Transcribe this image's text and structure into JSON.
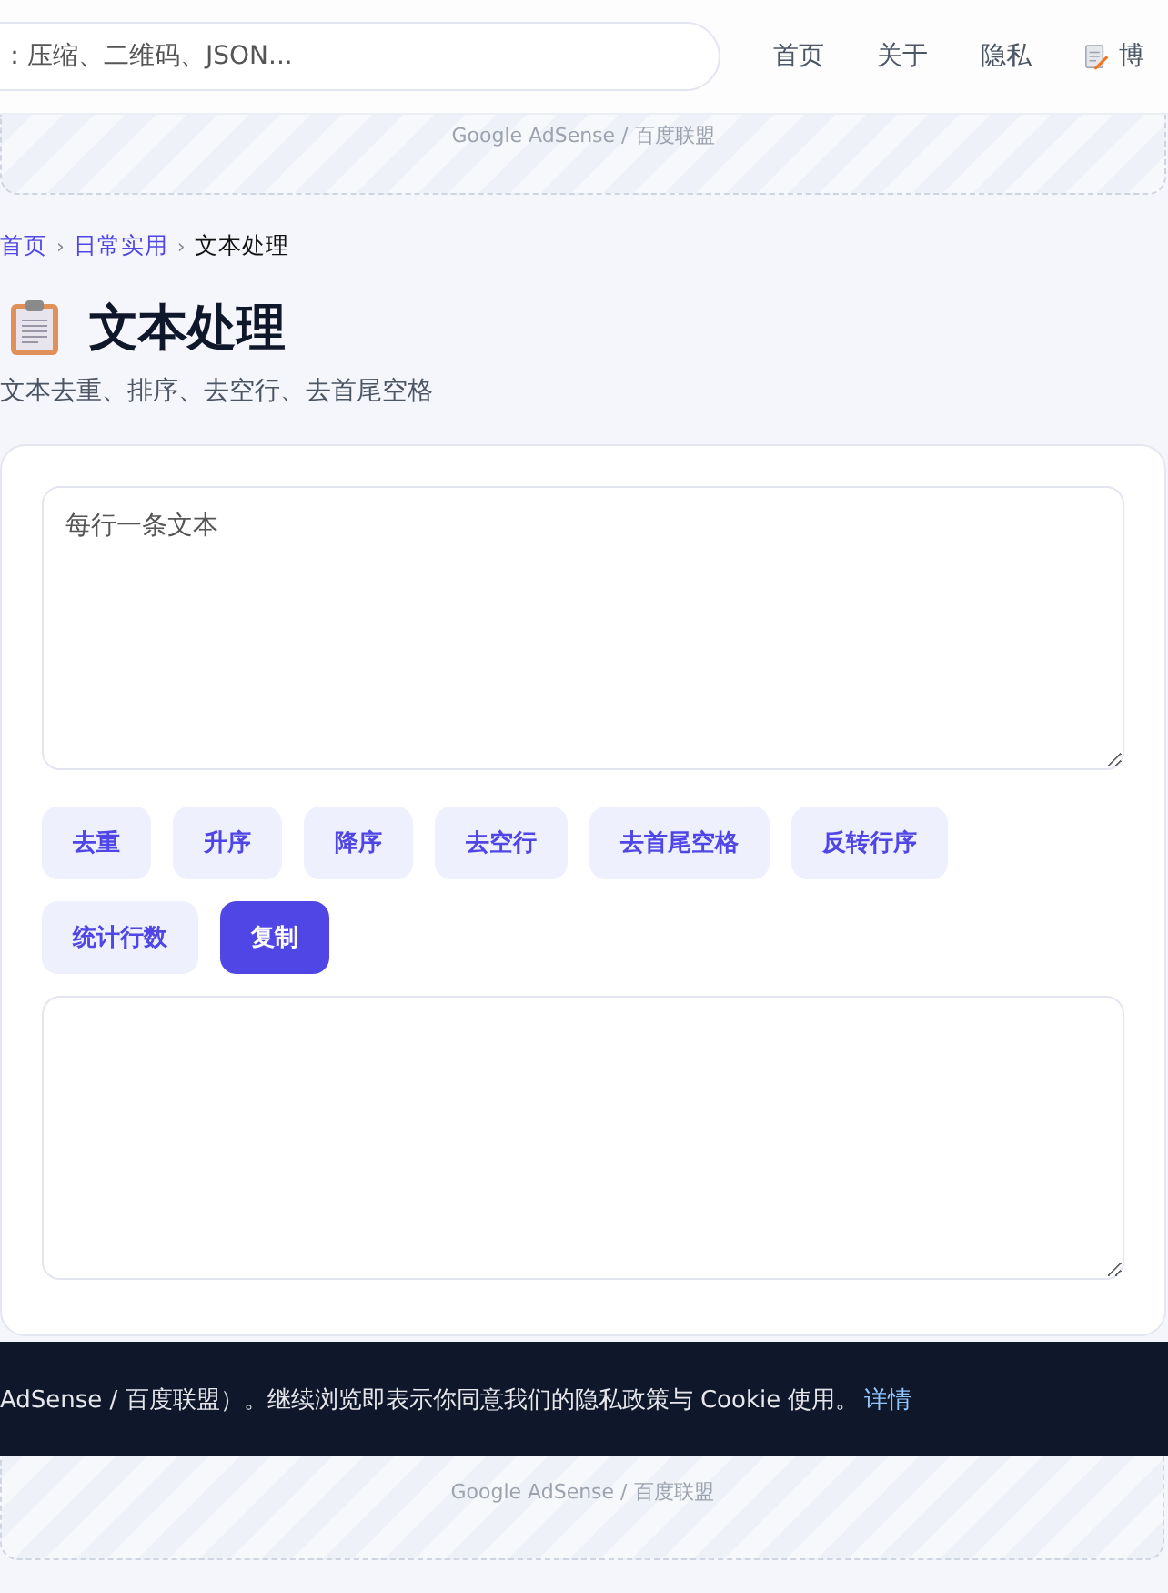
{
  "header": {
    "search": {
      "placeholder": "：压缩、二维码、JSON..."
    },
    "nav": [
      {
        "label": "首页",
        "kind": "text"
      },
      {
        "label": "关于",
        "kind": "text"
      },
      {
        "label": "隐私",
        "kind": "text"
      },
      {
        "label": "博",
        "kind": "icon"
      }
    ]
  },
  "ad_top": {
    "label": "Google AdSense / 百度联盟"
  },
  "breadcrumb_separator": "›",
  "breadcrumb": [
    {
      "label": "首页",
      "kind": "link"
    },
    {
      "label": "日常实用",
      "kind": "link"
    },
    {
      "label": "文本处理",
      "kind": "current"
    }
  ],
  "title": "文本处理",
  "subtitle": "文本去重、排序、去空行、去首尾空格",
  "tool": {
    "input": {
      "placeholder": "每行一条文本"
    },
    "buttons": [
      {
        "label": "去重",
        "kind": "secondary"
      },
      {
        "label": "升序",
        "kind": "secondary"
      },
      {
        "label": "降序",
        "kind": "secondary"
      },
      {
        "label": "去空行",
        "kind": "secondary"
      },
      {
        "label": "去首尾空格",
        "kind": "secondary"
      },
      {
        "label": "反转行序",
        "kind": "secondary"
      },
      {
        "label": "统计行数",
        "kind": "secondary"
      },
      {
        "label": "复制",
        "kind": "primary"
      }
    ]
  },
  "ad_bottom": {
    "label": "Google AdSense / 百度联盟"
  },
  "cookie_banner": {
    "text": "AdSense / 百度联盟）。继续浏览即表示你同意我们的隐私政策与 Cookie 使用。",
    "link": "详情"
  }
}
